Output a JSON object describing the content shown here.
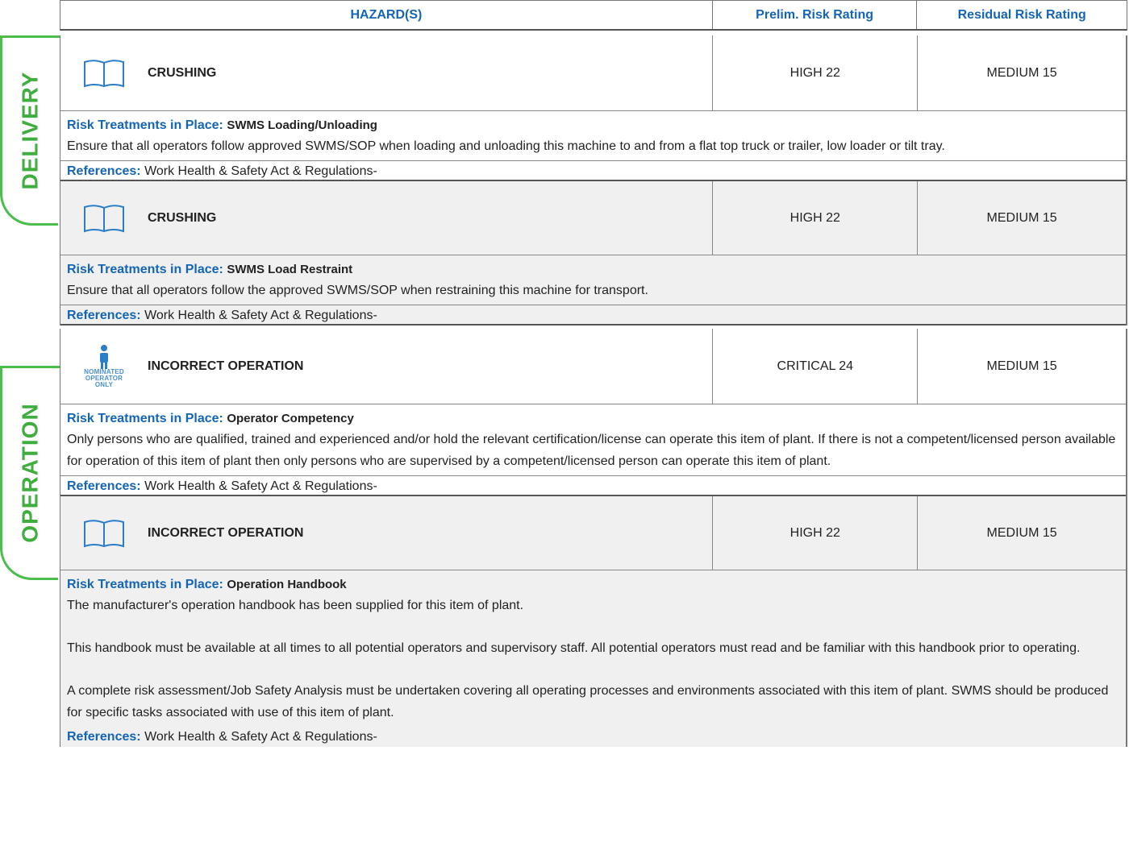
{
  "header": {
    "hazards": "HAZARD(S)",
    "prelim": "Prelim. Risk Rating",
    "residual": "Residual Risk Rating"
  },
  "sections": [
    {
      "label": "DELIVERY"
    },
    {
      "label": "OPERATION"
    }
  ],
  "labels": {
    "treatments": "Risk Treatments in Place:",
    "references": "References:"
  },
  "entries": [
    {
      "icon": "book-icon",
      "hazard": "CRUSHING",
      "prelim": "HIGH 22",
      "residual": "MEDIUM 15",
      "treatment_title": "SWMS Loading/Unloading",
      "paragraphs": [
        "Ensure that all operators follow approved SWMS/SOP when loading and unloading this machine to and from a flat top truck or trailer, low loader or tilt tray."
      ],
      "references": "Work Health & Safety Act & Regulations-"
    },
    {
      "icon": "book-icon",
      "hazard": "CRUSHING",
      "prelim": "HIGH 22",
      "residual": "MEDIUM 15",
      "treatment_title": "SWMS Load Restraint",
      "paragraphs": [
        "Ensure that all operators follow the approved SWMS/SOP when restraining this machine for transport."
      ],
      "references": "Work Health & Safety Act & Regulations-"
    },
    {
      "icon": "nominated-operator-icon",
      "icon_text": [
        "NOMINATED",
        "OPERATOR",
        "ONLY"
      ],
      "hazard": "INCORRECT OPERATION",
      "prelim": "CRITICAL 24",
      "residual": "MEDIUM 15",
      "treatment_title": "Operator Competency",
      "paragraphs": [
        "Only persons who are qualified, trained and experienced and/or hold the relevant certification/license can operate this item of plant. If there is not a competent/licensed person available for operation of this item of plant then only persons who are supervised by a competent/licensed person can operate this item of plant."
      ],
      "references": "Work Health & Safety Act & Regulations-"
    },
    {
      "icon": "book-icon",
      "hazard": "INCORRECT OPERATION",
      "prelim": "HIGH 22",
      "residual": "MEDIUM 15",
      "treatment_title": "Operation Handbook",
      "paragraphs": [
        "The manufacturer's operation handbook has been supplied for this item of plant.",
        "This handbook must be available at all times to all potential operators and supervisory staff. All potential operators must read and be familiar with this handbook prior to operating.",
        "A complete risk assessment/Job Safety Analysis must be undertaken covering all operating processes and environments associated with this item of plant. SWMS should be produced for specific tasks associated with use of this item of plant."
      ],
      "references": "Work Health & Safety Act & Regulations-"
    }
  ]
}
